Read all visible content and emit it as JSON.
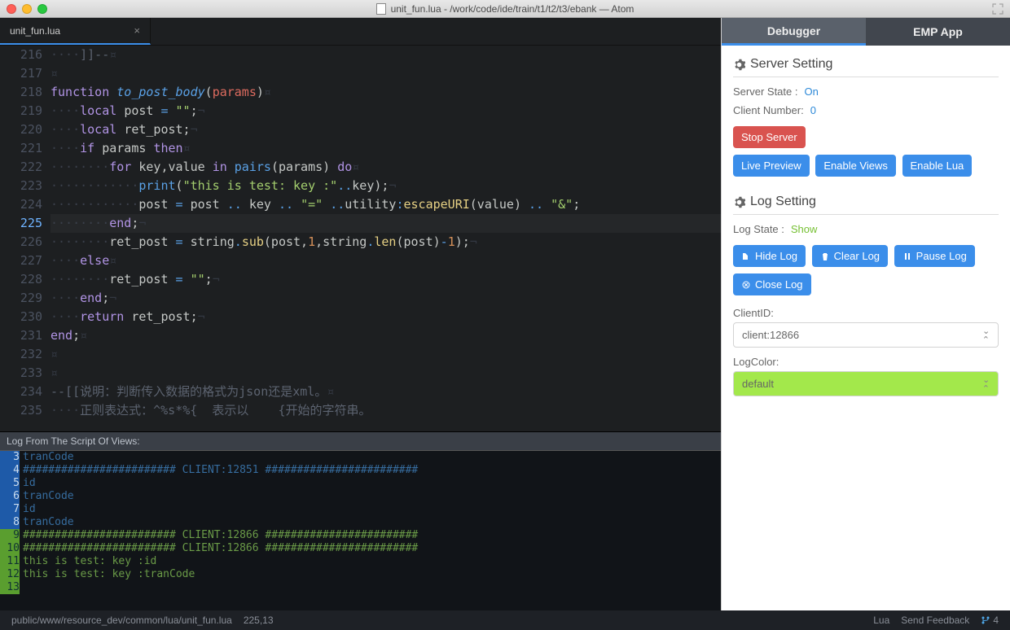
{
  "window": {
    "title": "unit_fun.lua - /work/code/ide/train/t1/t2/t3/ebank — Atom"
  },
  "tabs": {
    "file": "unit_fun.lua"
  },
  "editor": {
    "active_line": 225,
    "lines": [
      {
        "n": 216,
        "html": "<span class='invis'>····</span><span class='comment'>]]--</span><span class='invis2'>¤</span>"
      },
      {
        "n": 217,
        "html": "<span class='invis2'>¤</span>"
      },
      {
        "n": 218,
        "html": "<span class='kw'>function</span> <span class='fn'>to_post_body</span><span class='plain'>(</span><span class='id'>params</span><span class='plain'>)</span><span class='invis2'>¤</span>"
      },
      {
        "n": 219,
        "html": "<span class='invis'>····</span><span class='kw'>local</span> <span class='plain'>post</span> <span class='op'>=</span> <span class='str'>\"\"</span><span class='plain'>;</span><span class='invis2'>¬</span>"
      },
      {
        "n": 220,
        "html": "<span class='invis'>····</span><span class='kw'>local</span> <span class='plain'>ret_post;</span><span class='invis2'>¬</span>"
      },
      {
        "n": 221,
        "html": "<span class='invis'>····</span><span class='kw'>if</span> <span class='plain'>params</span> <span class='kw'>then</span><span class='invis2'>¤</span>"
      },
      {
        "n": 222,
        "html": "<span class='invis'>········</span><span class='kw'>for</span> <span class='plain'>key,value</span> <span class='kw'>in</span> <span class='op'>pairs</span><span class='plain'>(params)</span> <span class='kw'>do</span><span class='invis2'>¤</span>"
      },
      {
        "n": 223,
        "html": "<span class='invis'>············</span><span class='op'>print</span><span class='plain'>(</span><span class='str'>\"this is test: key :\"</span><span class='op'>..</span><span class='plain'>key);</span><span class='invis2'>¬</span>"
      },
      {
        "n": 224,
        "html": "<span class='invis'>············</span><span class='plain'>post</span> <span class='op'>=</span> <span class='plain'>post</span> <span class='op'>..</span> <span class='plain'>key</span> <span class='op'>..</span> <span class='str'>\"=\"</span> <span class='op'>..</span><span class='plain'>utility</span><span class='op'>:</span><span class='obj'>escapeURI</span><span class='plain'>(value)</span> <span class='op'>..</span> <span class='str'>\"&amp;\"</span><span class='plain'>;</span>"
      },
      {
        "n": 225,
        "html": "<span class='invis'>········</span><span class='kw'>end</span><span class='plain'>;</span><span class='invis2'>¬</span>"
      },
      {
        "n": 226,
        "html": "<span class='invis'>········</span><span class='plain'>ret_post</span> <span class='op'>=</span> <span class='plain'>string</span><span class='op'>.</span><span class='obj'>sub</span><span class='plain'>(post,</span><span class='num'>1</span><span class='plain'>,string</span><span class='op'>.</span><span class='obj'>len</span><span class='plain'>(post)</span><span class='op'>-</span><span class='num'>1</span><span class='plain'>);</span><span class='invis2'>¬</span>"
      },
      {
        "n": 227,
        "html": "<span class='invis'>····</span><span class='kw'>else</span><span class='invis2'>¤</span>"
      },
      {
        "n": 228,
        "html": "<span class='invis'>········</span><span class='plain'>ret_post</span> <span class='op'>=</span> <span class='str'>\"\"</span><span class='plain'>;</span><span class='invis2'>¬</span>"
      },
      {
        "n": 229,
        "html": "<span class='invis'>····</span><span class='kw'>end</span><span class='plain'>;</span><span class='invis2'>¬</span>"
      },
      {
        "n": 230,
        "html": "<span class='invis'>····</span><span class='kw'>return</span> <span class='plain'>ret_post;</span><span class='invis2'>¬</span>"
      },
      {
        "n": 231,
        "html": "<span class='kw'>end</span><span class='plain'>;</span><span class='invis2'>¤</span>"
      },
      {
        "n": 232,
        "html": "<span class='invis2'>¤</span>"
      },
      {
        "n": 233,
        "html": "<span class='invis2'>¤</span>"
      },
      {
        "n": 234,
        "html": "<span class='comment'>--[[说明：判断传入数据的格式为json还是xml。</span><span class='invis2'>¤</span>"
      },
      {
        "n": 235,
        "html": "<span class='invis'>····</span><span class='comment'>正则表达式：^%s*%{  表示以    {开始的字符串。</span>"
      }
    ]
  },
  "log": {
    "title": "Log From The Script Of Views:",
    "rows": [
      {
        "n": 3,
        "cls": "lg-blue",
        "txt": "tranCode",
        "tc": "lc-a"
      },
      {
        "n": 4,
        "cls": "lg-blue",
        "txt": "######################## CLIENT:12851 ########################",
        "tc": "lc-a"
      },
      {
        "n": 5,
        "cls": "lg-blue",
        "txt": "id",
        "tc": "lc-a"
      },
      {
        "n": 6,
        "cls": "lg-blue",
        "txt": "tranCode",
        "tc": "lc-a"
      },
      {
        "n": 7,
        "cls": "lg-blue",
        "txt": "id",
        "tc": "lc-a"
      },
      {
        "n": 8,
        "cls": "lg-blue",
        "txt": "tranCode",
        "tc": "lc-a"
      },
      {
        "n": 9,
        "cls": "lg-green",
        "txt": "######################## CLIENT:12866 ########################",
        "tc": "lc-b"
      },
      {
        "n": 10,
        "cls": "lg-green",
        "txt": "######################## CLIENT:12866 ########################",
        "tc": "lc-b"
      },
      {
        "n": 11,
        "cls": "lg-green",
        "txt": "this is test: key :id",
        "tc": "lc-b"
      },
      {
        "n": 12,
        "cls": "lg-green",
        "txt": "this is test: key :tranCode",
        "tc": "lc-b"
      },
      {
        "n": 13,
        "cls": "lg-green",
        "txt": "",
        "tc": "lc-b"
      }
    ]
  },
  "panel": {
    "tabs": [
      "Debugger",
      "EMP App"
    ],
    "server_setting": {
      "title": "Server Setting",
      "state_label": "Server State :",
      "state_value": "On",
      "client_label": "Client Number:",
      "client_value": "0",
      "stop": "Stop Server",
      "live_preview": "Live Preview",
      "enable_views": "Enable Views",
      "enable_lua": "Enable Lua"
    },
    "log_setting": {
      "title": "Log Setting",
      "state_label": "Log State :",
      "state_value": "Show",
      "hide": "Hide Log",
      "clear": "Clear Log",
      "pause": "Pause Log",
      "close": "Close Log",
      "clientid_label": "ClientID:",
      "clientid_value": "client:12866",
      "logcolor_label": "LogColor:",
      "logcolor_value": "default"
    }
  },
  "status": {
    "path": "public/www/resource_dev/common/lua/unit_fun.lua",
    "pos": "225,13",
    "lang": "Lua",
    "feedback": "Send Feedback",
    "git": "4"
  }
}
